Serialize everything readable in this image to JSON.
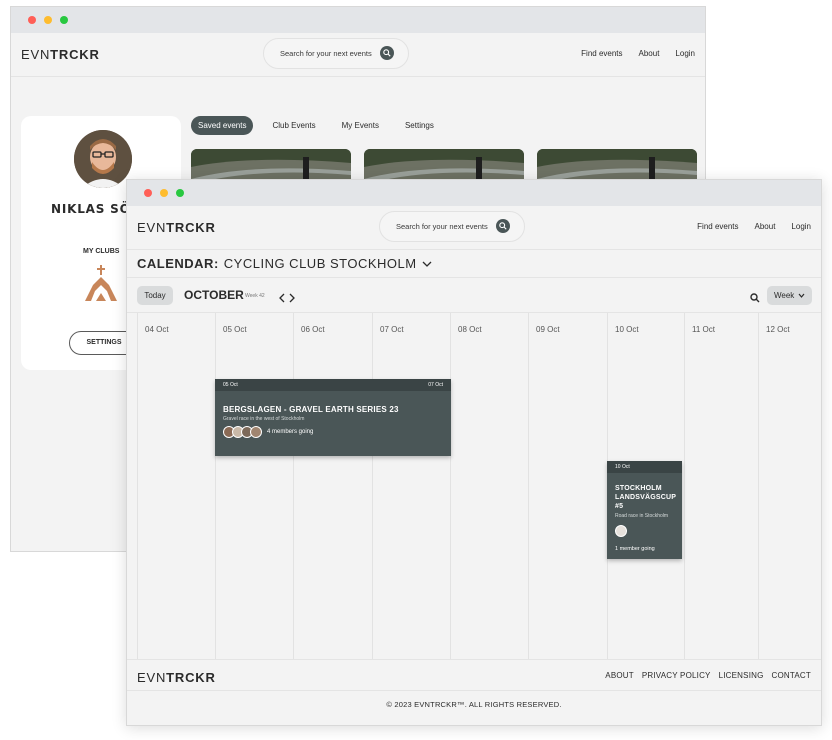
{
  "brand": {
    "logo_light": "EVN",
    "logo_bold": "TRCKR"
  },
  "search": {
    "placeholder": "Search for your next events"
  },
  "nav": {
    "links": [
      "Find events",
      "About",
      "Login"
    ]
  },
  "profile": {
    "name": "NIKLAS SÖDER",
    "clubs_label": "MY CLUBS",
    "settings_label": "SETTINGS"
  },
  "tabs": [
    "Saved events",
    "Club Events",
    "My Events",
    "Settings"
  ],
  "calendar": {
    "label": "CALENDAR:",
    "club": "CYCLING CLUB STOCKHOLM",
    "today_label": "Today",
    "month": "OCTOBER",
    "week": "Week 42",
    "view": "Week",
    "days": [
      "04 Oct",
      "05 Oct",
      "06 Oct",
      "07 Oct",
      "08 Oct",
      "09 Oct",
      "10 Oct",
      "11 Oct",
      "12 Oct"
    ]
  },
  "events": [
    {
      "start": "05 Oct",
      "end": "07 Oct",
      "title": "BERGSLAGEN - GRAVEL EARTH SERIES 23",
      "subtitle": "Gravel race in the west of Stockholm",
      "going": "4 members going"
    },
    {
      "start": "10 Oct",
      "title": "STOCKHOLM LANDSVÄGSCUP #5",
      "subtitle": "Road race in Stockholm",
      "going": "1 member going"
    }
  ],
  "footer": {
    "links": [
      "ABOUT",
      "PRIVACY POLICY",
      "LICENSING",
      "CONTACT"
    ],
    "copyright": "© 2023 EVNTRCKR™. ALL RIGHTS RESERVED."
  },
  "colors": {
    "accent": "#4a5657",
    "background": "#f3f3f3",
    "titlebar": "#e3e5e8"
  }
}
